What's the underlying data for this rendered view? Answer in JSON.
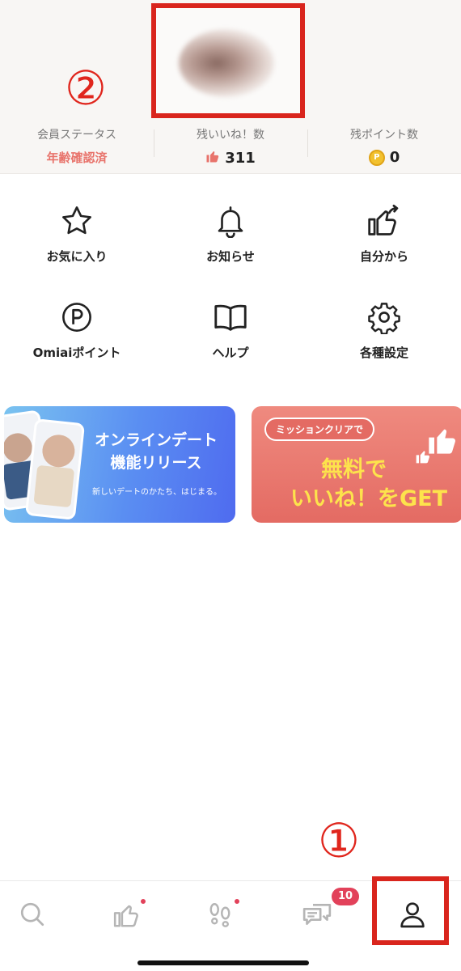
{
  "annotations": {
    "one": "①",
    "two": "②"
  },
  "stats": [
    {
      "label": "会員ステータス",
      "value": "年齢確認済"
    },
    {
      "label": "残いいね！数",
      "value": "311",
      "icon": "thumbs-up-icon"
    },
    {
      "label": "残ポイント数",
      "value": "0",
      "icon": "point-coin-icon",
      "coin_mark": "P"
    }
  ],
  "menu": [
    {
      "label": "お気に入り",
      "icon": "star-icon"
    },
    {
      "label": "お知らせ",
      "icon": "bell-icon"
    },
    {
      "label": "自分から",
      "icon": "thumbs-up-share-icon"
    },
    {
      "label": "Omiaiポイント",
      "icon": "point-icon"
    },
    {
      "label": "ヘルプ",
      "icon": "book-icon"
    },
    {
      "label": "各種設定",
      "icon": "gear-icon"
    }
  ],
  "banners": [
    {
      "title_line1": "オンラインデート",
      "title_line2": "機能リリース",
      "subtitle": "新しいデートのかたち、はじまる。"
    },
    {
      "pill": "ミッションクリアで",
      "line1": "無料で",
      "line2": "いいね！をGET"
    }
  ],
  "nav": {
    "items": [
      "search-icon",
      "like-icon",
      "footprints-icon",
      "messages-icon",
      "profile-icon"
    ],
    "message_badge": "10"
  },
  "colors": {
    "accent_red": "#d9251d",
    "badge": "#e2415a",
    "status_text": "#e8736b"
  }
}
